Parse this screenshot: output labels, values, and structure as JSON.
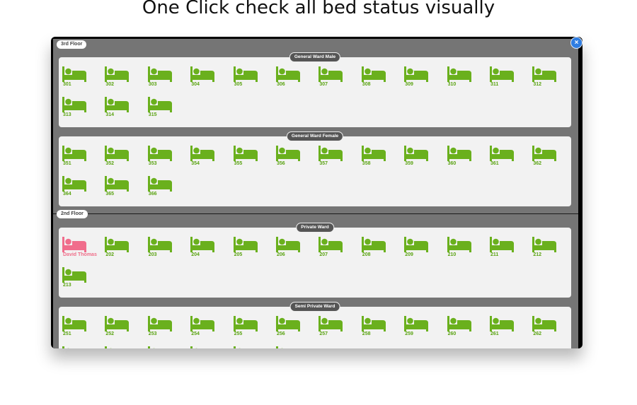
{
  "page": {
    "title": "One Click check all bed status visually"
  },
  "colors": {
    "available": "#6ab01d",
    "occupied": "#f06d8c",
    "accent_close": "#2f7de1"
  },
  "icons": {
    "bed": "bed-icon",
    "close": "close-icon"
  },
  "close_label": "×",
  "floors": [
    {
      "label": "3rd Floor",
      "wards": [
        {
          "label": "General Ward Male",
          "beds": [
            {
              "label": "301",
              "status": "available"
            },
            {
              "label": "302",
              "status": "available"
            },
            {
              "label": "303",
              "status": "available"
            },
            {
              "label": "304",
              "status": "available"
            },
            {
              "label": "305",
              "status": "available"
            },
            {
              "label": "306",
              "status": "available"
            },
            {
              "label": "307",
              "status": "available"
            },
            {
              "label": "308",
              "status": "available"
            },
            {
              "label": "309",
              "status": "available"
            },
            {
              "label": "310",
              "status": "available"
            },
            {
              "label": "311",
              "status": "available"
            },
            {
              "label": "312",
              "status": "available"
            },
            {
              "label": "313",
              "status": "available"
            },
            {
              "label": "314",
              "status": "available"
            },
            {
              "label": "315",
              "status": "available"
            }
          ]
        },
        {
          "label": "General Ward Female",
          "beds": [
            {
              "label": "351",
              "status": "available"
            },
            {
              "label": "352",
              "status": "available"
            },
            {
              "label": "353",
              "status": "available"
            },
            {
              "label": "354",
              "status": "available"
            },
            {
              "label": "355",
              "status": "available"
            },
            {
              "label": "356",
              "status": "available"
            },
            {
              "label": "357",
              "status": "available"
            },
            {
              "label": "358",
              "status": "available"
            },
            {
              "label": "359",
              "status": "available"
            },
            {
              "label": "360",
              "status": "available"
            },
            {
              "label": "361",
              "status": "available"
            },
            {
              "label": "362",
              "status": "available"
            },
            {
              "label": "364",
              "status": "available"
            },
            {
              "label": "365",
              "status": "available"
            },
            {
              "label": "366",
              "status": "available"
            }
          ]
        }
      ]
    },
    {
      "label": "2nd Floor",
      "wards": [
        {
          "label": "Private Ward",
          "beds": [
            {
              "label": "David Thomas",
              "status": "occupied"
            },
            {
              "label": "202",
              "status": "available"
            },
            {
              "label": "203",
              "status": "available"
            },
            {
              "label": "204",
              "status": "available"
            },
            {
              "label": "205",
              "status": "available"
            },
            {
              "label": "206",
              "status": "available"
            },
            {
              "label": "207",
              "status": "available"
            },
            {
              "label": "208",
              "status": "available"
            },
            {
              "label": "209",
              "status": "available"
            },
            {
              "label": "210",
              "status": "available"
            },
            {
              "label": "211",
              "status": "available"
            },
            {
              "label": "212",
              "status": "available"
            },
            {
              "label": "213",
              "status": "available"
            }
          ]
        },
        {
          "label": "Semi Private Ward",
          "beds": [
            {
              "label": "251",
              "status": "available"
            },
            {
              "label": "252",
              "status": "available"
            },
            {
              "label": "253",
              "status": "available"
            },
            {
              "label": "254",
              "status": "available"
            },
            {
              "label": "255",
              "status": "available"
            },
            {
              "label": "256",
              "status": "available"
            },
            {
              "label": "257",
              "status": "available"
            },
            {
              "label": "258",
              "status": "available"
            },
            {
              "label": "259",
              "status": "available"
            },
            {
              "label": "260",
              "status": "available"
            },
            {
              "label": "261",
              "status": "available"
            },
            {
              "label": "262",
              "status": "available"
            },
            {
              "label": "",
              "status": "available"
            },
            {
              "label": "",
              "status": "available"
            },
            {
              "label": "",
              "status": "available"
            },
            {
              "label": "",
              "status": "available"
            },
            {
              "label": "",
              "status": "available"
            },
            {
              "label": "",
              "status": "available"
            }
          ]
        }
      ]
    }
  ]
}
